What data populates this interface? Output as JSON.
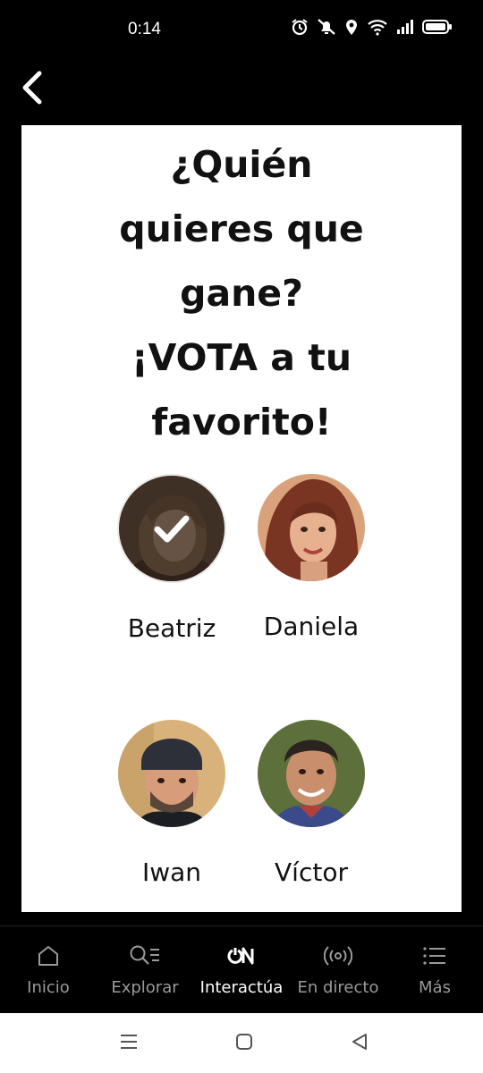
{
  "status_bar": {
    "time": "0:14",
    "icons": [
      "alarm-icon",
      "mute-icon",
      "location-icon",
      "wifi-icon",
      "signal-icon",
      "battery-icon"
    ]
  },
  "header": {
    "back_icon": "chevron-left-icon"
  },
  "poll": {
    "title_lines": [
      "¿Quién",
      "quieres que",
      "gane?",
      "¡VOTA a tu",
      "favorito!"
    ],
    "candidates": [
      {
        "name": "Beatriz",
        "selected": true
      },
      {
        "name": "Daniela",
        "selected": false
      },
      {
        "name": "Iwan",
        "selected": false
      },
      {
        "name": "Víctor",
        "selected": false
      }
    ]
  },
  "bottom_nav": {
    "items": [
      {
        "label": "Inicio",
        "icon": "home-icon",
        "active": false
      },
      {
        "label": "Explorar",
        "icon": "search-list-icon",
        "active": false
      },
      {
        "label": "Interactúa",
        "icon": "on-logo-icon",
        "active": true
      },
      {
        "label": "En directo",
        "icon": "broadcast-icon",
        "active": false
      },
      {
        "label": "Más",
        "icon": "menu-icon",
        "active": false
      }
    ]
  },
  "system_nav": {
    "icons": [
      "recents-icon",
      "home-button-icon",
      "back-triangle-icon"
    ]
  }
}
